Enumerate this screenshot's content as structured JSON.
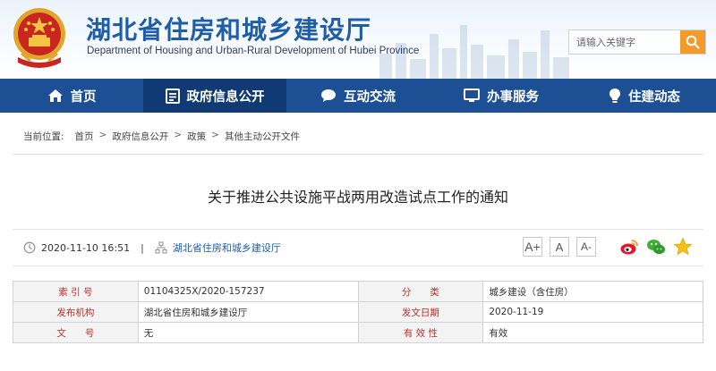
{
  "header": {
    "title": "湖北省住房和城乡建设厅",
    "subtitle": "Department of Housing and Urban-Rural Development of Hubei Province",
    "search_placeholder": "请输入关键字"
  },
  "nav": [
    {
      "label": "首页",
      "icon": "home-icon"
    },
    {
      "label": "政府信息公开",
      "icon": "document-icon",
      "active": true
    },
    {
      "label": "互动交流",
      "icon": "chat-bubble-icon"
    },
    {
      "label": "办事服务",
      "icon": "monitor-icon"
    },
    {
      "label": "住建动态",
      "icon": "lightbulb-icon"
    }
  ],
  "breadcrumb": {
    "label": "当前位置:",
    "items": [
      "首页",
      "政府信息公开",
      "政策",
      "其他主动公开文件"
    ]
  },
  "article": {
    "title": "关于推进公共设施平战两用改造试点工作的通知",
    "datetime": "2020-11-10 16:51",
    "divider": "|",
    "source": "湖北省住房和城乡建设厅"
  },
  "font_sizes": [
    "A+",
    "A",
    "A-"
  ],
  "share": [
    "weibo-icon",
    "wechat-icon",
    "favorite-star-icon"
  ],
  "info_table": [
    {
      "l1": "索 引 号",
      "v1": "01104325X/2020-157237",
      "l2": "分　　类",
      "v2": "城乡建设（含住房）"
    },
    {
      "l1": "发布机构",
      "v1": "湖北省住房和城乡建设厅",
      "l2": "发文日期",
      "v2": "2020-11-19"
    },
    {
      "l1": "文　　号",
      "v1": "无",
      "l2": "有 效 性",
      "v2": "有效"
    }
  ],
  "colors": {
    "brand_blue": "#1f5da8",
    "nav_bg": "#1c4f93",
    "nav_active": "#0f3a73",
    "search_button": "#f29b2a",
    "table_label": "#b5322a"
  }
}
